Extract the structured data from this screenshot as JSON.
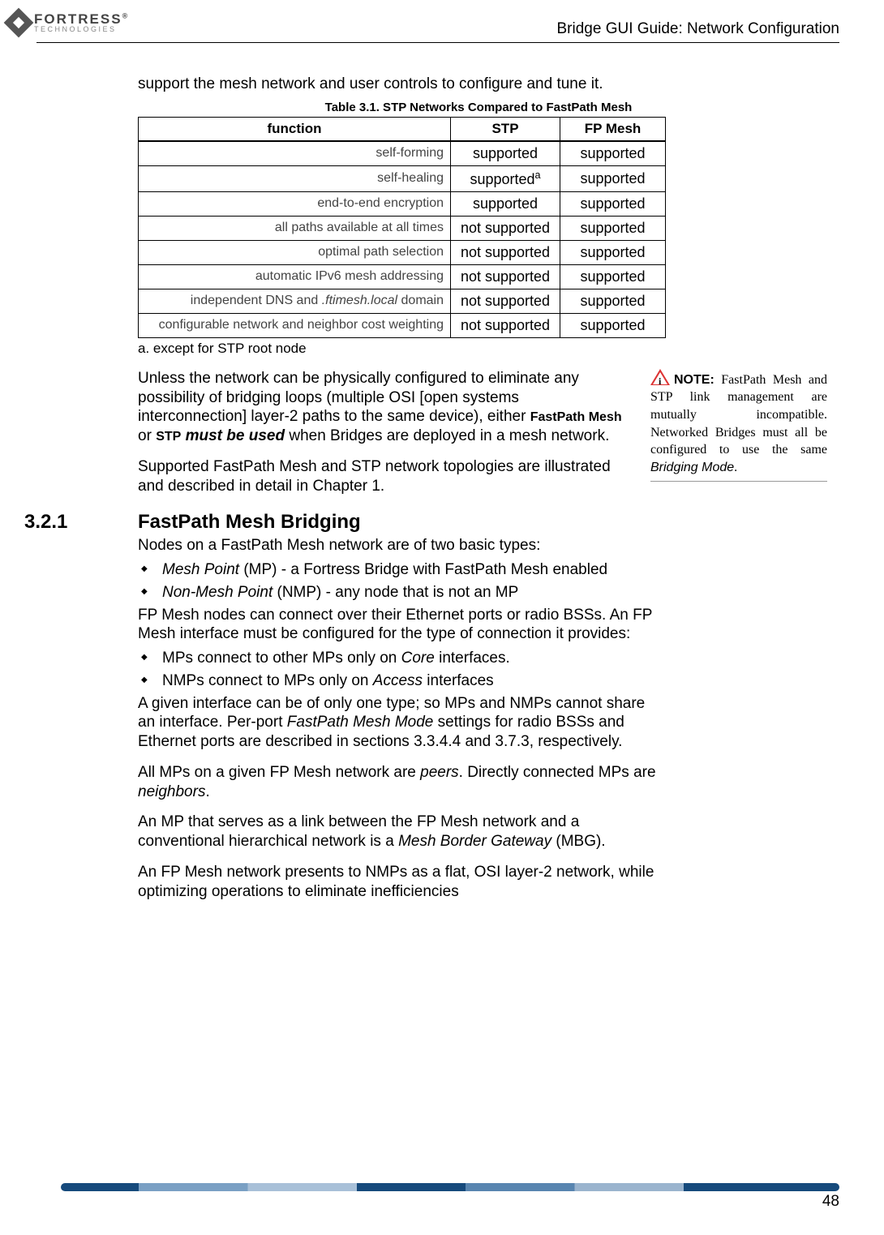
{
  "header": {
    "logo_main": "FORTRESS",
    "logo_sub": "TECHNOLOGIES",
    "reg": "®",
    "guide_title": "Bridge GUI Guide: Network Configuration"
  },
  "intro": "support the mesh network and user controls to configure and tune it.",
  "table": {
    "title": "Table 3.1. STP Networks Compared to FastPath Mesh",
    "headers": {
      "fn": "function",
      "stp": "STP",
      "fp": "FP Mesh"
    },
    "rows": [
      {
        "fn": "self-forming",
        "stp": "supported",
        "fp": "supported",
        "sup": ""
      },
      {
        "fn": "self-healing",
        "stp": "supported",
        "fp": "supported",
        "sup": "a"
      },
      {
        "fn": "end-to-end encryption",
        "stp": "supported",
        "fp": "supported",
        "sup": ""
      },
      {
        "fn": "all paths available at all times",
        "stp": "not supported",
        "fp": "supported",
        "sup": ""
      },
      {
        "fn": "optimal path selection",
        "stp": "not supported",
        "fp": "supported",
        "sup": ""
      },
      {
        "fn": "automatic IPv6 mesh addressing",
        "stp": "not supported",
        "fp": "supported",
        "sup": ""
      },
      {
        "fn": "independent DNS and .ftimesh.local domain",
        "stp": "not supported",
        "fp": "supported",
        "sup": ""
      },
      {
        "fn": "configurable network and neighbor cost weighting",
        "stp": "not supported",
        "fp": "supported",
        "sup": ""
      }
    ],
    "footnote": "a. except for STP root node"
  },
  "para1_prefix": "Unless the network can be physically configured to eliminate any possibility of bridging loops (multiple OSI [open systems interconnection] layer-2 paths to the same device), either ",
  "para1_fpm": "FastPath Mesh",
  "para1_or": " or ",
  "para1_stp": "STP",
  "para1_must": " must be used",
  "para1_suffix": " when Bridges are deployed in a mesh network.",
  "para2": "Supported FastPath Mesh and STP network topologies are illustrated and described in detail in Chapter 1.",
  "note": {
    "label": "NOTE:",
    "body_prefix": "FastPath Mesh and STP link management are mutually incompatible. Networked Bridges must all be configured to use the same ",
    "body_italic": "Bridging Mode",
    "body_suffix": "."
  },
  "section": {
    "num": "3.2.1",
    "title": "FastPath Mesh Bridging",
    "p1": "Nodes on a FastPath Mesh network are of two basic types:",
    "b1_i": "Mesh Point",
    "b1_t": " (MP) - a Fortress Bridge with FastPath Mesh enabled",
    "b2_i": "Non-Mesh Point",
    "b2_t": " (NMP) - any node that is not an MP",
    "p2": "FP Mesh nodes can connect over their Ethernet ports or radio BSSs. An FP Mesh interface must be configured for the type of connection it provides:",
    "b3_pre": "MPs connect to other MPs only on ",
    "b3_i": "Core",
    "b3_post": " interfaces.",
    "b4_pre": "NMPs connect to MPs only on ",
    "b4_i": "Access",
    "b4_post": " interfaces",
    "p3_pre": "A given interface can be of only one type; so MPs and NMPs cannot share an interface. Per-port ",
    "p3_i": "FastPath Mesh Mode",
    "p3_post": " settings for radio BSSs and Ethernet ports are described in sections 3.3.4.4 and 3.7.3, respectively.",
    "p4_pre": "All MPs on a given FP Mesh network are ",
    "p4_i1": "peers",
    "p4_mid": ". Directly connected MPs are ",
    "p4_i2": "neighbors",
    "p4_post": ".",
    "p5_pre": "An MP that serves as a link between the FP Mesh network and a conventional hierarchical network is a ",
    "p5_i": "Mesh Border Gateway",
    "p5_post": " (MBG).",
    "p6": "An FP Mesh network presents to NMPs as a flat, OSI layer-2 network, while optimizing operations to eliminate inefficiencies"
  },
  "page_num": "48"
}
